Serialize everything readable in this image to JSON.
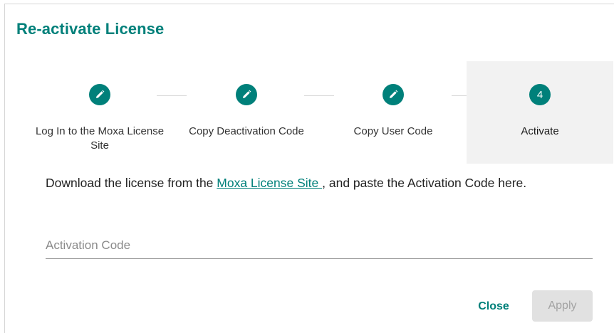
{
  "dialog": {
    "title": "Re-activate License"
  },
  "steps": [
    {
      "label": "Log In to the Moxa License Site",
      "state": "completed",
      "icon": "pencil-icon"
    },
    {
      "label": "Copy Deactivation Code",
      "state": "completed",
      "icon": "pencil-icon"
    },
    {
      "label": "Copy User Code",
      "state": "completed",
      "icon": "pencil-icon"
    },
    {
      "label": "Activate",
      "state": "active",
      "number": "4"
    }
  ],
  "instructions": {
    "prefix": "Download the license from the ",
    "link_text": "Moxa License Site ",
    "suffix": ", and paste the Activation Code here."
  },
  "activation_field": {
    "value": "",
    "placeholder": "Activation Code"
  },
  "actions": {
    "close_label": "Close",
    "apply_label": "Apply",
    "apply_disabled": true
  },
  "colors": {
    "accent": "#00807a",
    "active_step_bg": "#f2f2f2",
    "disabled_button_bg": "#e1e1e1"
  }
}
